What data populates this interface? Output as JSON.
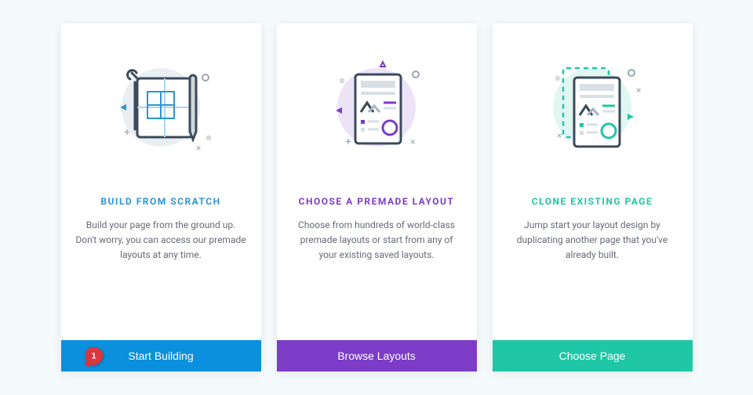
{
  "cards": [
    {
      "title": "BUILD FROM SCRATCH",
      "desc": "Build your page from the ground up. Don't worry, you can access our premade layouts at any time.",
      "button": "Start Building",
      "accent": "#0a90dd"
    },
    {
      "title": "CHOOSE A PREMADE LAYOUT",
      "desc": "Choose from hundreds of world-class premade layouts or start from any of your existing saved layouts.",
      "button": "Browse Layouts",
      "accent": "#7c3cc7"
    },
    {
      "title": "CLONE EXISTING PAGE",
      "desc": "Jump start your layout design by duplicating another page that you've already built.",
      "button": "Choose Page",
      "accent": "#1fc7a6"
    }
  ],
  "annotation": {
    "number": "1"
  }
}
